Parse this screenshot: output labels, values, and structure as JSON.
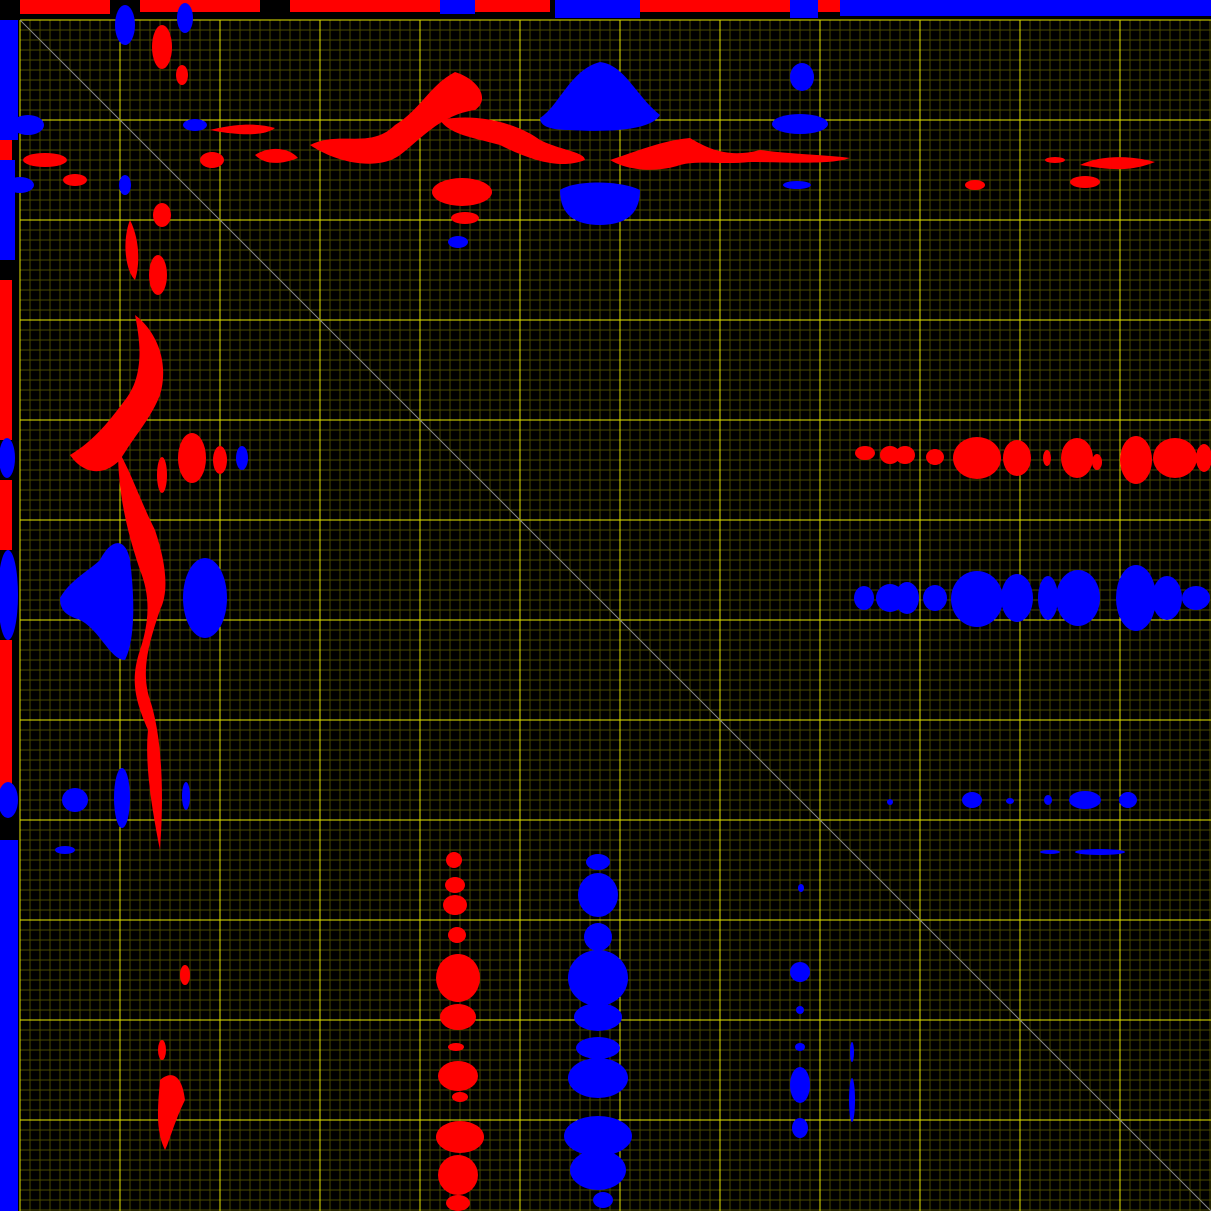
{
  "colors": {
    "background": "#000000",
    "minor_grid": "#4a4a00",
    "major_grid": "#e6e600",
    "diagonal": "#8a8a8a",
    "positive_contour": "#ff0000",
    "negative_contour": "#0000ff"
  },
  "grid": true,
  "diagonal_line": true
}
